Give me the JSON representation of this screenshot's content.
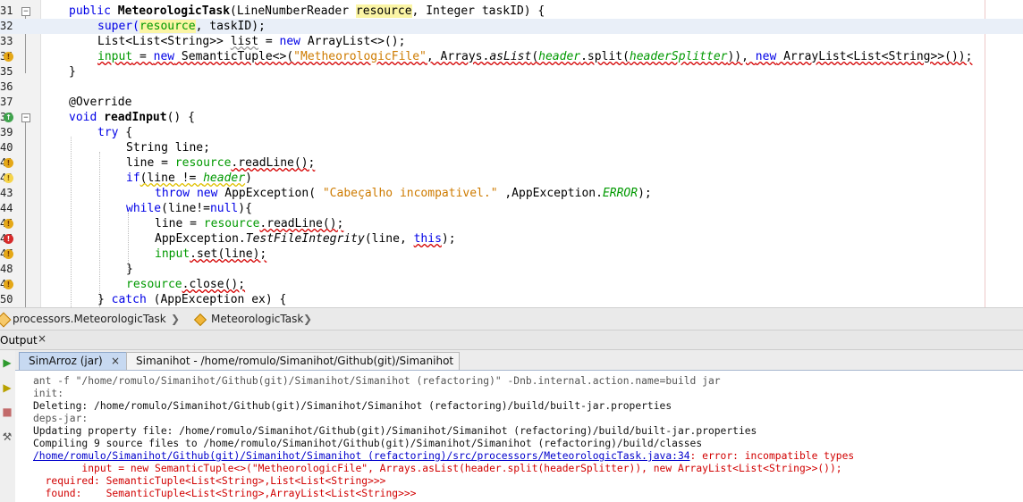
{
  "editor": {
    "lines": [
      {
        "num": "31",
        "mark": "",
        "fold": "minus"
      },
      {
        "num": "32",
        "mark": "",
        "fold": ""
      },
      {
        "num": "33",
        "mark": "",
        "fold": ""
      },
      {
        "num": "34",
        "mark": "warn",
        "fold": ""
      },
      {
        "num": "35",
        "mark": "",
        "fold": ""
      },
      {
        "num": "36",
        "mark": "",
        "fold": ""
      },
      {
        "num": "37",
        "mark": "",
        "fold": ""
      },
      {
        "num": "38",
        "mark": "impl",
        "fold": "minus"
      },
      {
        "num": "39",
        "mark": "",
        "fold": ""
      },
      {
        "num": "40",
        "mark": "",
        "fold": ""
      },
      {
        "num": "41",
        "mark": "warn",
        "fold": ""
      },
      {
        "num": "42",
        "mark": "bulb",
        "fold": ""
      },
      {
        "num": "43",
        "mark": "",
        "fold": ""
      },
      {
        "num": "44",
        "mark": "",
        "fold": ""
      },
      {
        "num": "45",
        "mark": "warn",
        "fold": ""
      },
      {
        "num": "46",
        "mark": "err",
        "fold": ""
      },
      {
        "num": "47",
        "mark": "warn",
        "fold": ""
      },
      {
        "num": "48",
        "mark": "",
        "fold": ""
      },
      {
        "num": "49",
        "mark": "warn",
        "fold": ""
      },
      {
        "num": "50",
        "mark": "",
        "fold": ""
      }
    ],
    "code": {
      "l31": {
        "a": "public ",
        "b": "MeteorologicTask",
        "c": "(LineNumberReader ",
        "d": "resource",
        ".": "",
        "e": ", Integer taskID) {"
      },
      "l32": {
        "a": "super(",
        "b": "resource",
        "c": ", taskID);"
      },
      "l33": {
        "a": "List<List<String>> ",
        "b": "list",
        "c": " = ",
        "d": "new",
        "e": " ArrayList<>();"
      },
      "l34": {
        "a": "input",
        "b": " = ",
        "c": "new",
        "d": " SemanticTuple<>(",
        "e": "\"MetheorologicFile\"",
        "f": ", Arrays.",
        "g": "asList",
        "h": "(",
        "i": "header",
        "j": ".split(",
        "k": "headerSplitter",
        "l": ")), ",
        "m": "new",
        "n": " ArrayList<List<String>>());"
      },
      "l35": {
        "a": "}"
      },
      "l37": {
        "a": "@Override"
      },
      "l38": {
        "a": "void ",
        "b": "readInput",
        "c": "() {"
      },
      "l39": {
        "a": "try",
        "b": " {"
      },
      "l40": {
        "a": "String line;"
      },
      "l41": {
        "a": "line = ",
        "b": "resource",
        "c": ".readLine();"
      },
      "l42": {
        "a": "if",
        "b": "(line != ",
        "c": "header",
        "d": ")"
      },
      "l43": {
        "a": "throw",
        "b": " ",
        "c": "new",
        "d": " AppException( ",
        "e": "\"Cabeçalho incompativel.\"",
        "f": " ,AppException.",
        "g": "ERROR",
        "h": ");"
      },
      "l44": {
        "a": "while",
        "b": "(line!=",
        "c": "null",
        "d": "){"
      },
      "l45": {
        "a": "line = ",
        "b": "resource",
        "c": ".readLine();"
      },
      "l46": {
        "a": "AppException.",
        "b": "TestFileIntegrity",
        "c": "(line, ",
        "d": "this",
        "e": ");"
      },
      "l47": {
        "a": "input",
        "b": ".set(line);"
      },
      "l48": {
        "a": "}"
      },
      "l49": {
        "a": "resource",
        "b": ".close();"
      },
      "l50": {
        "a": "} ",
        "b": "catch",
        "c": " (AppException ex) {"
      }
    }
  },
  "navbar": {
    "crumb1": "processors.MeteorologicTask",
    "crumb2": "MeteorologicTask"
  },
  "output": {
    "title": "Output",
    "tabs": [
      {
        "label": "SimArroz (jar)",
        "close": "×"
      },
      {
        "label": "Simanihot - /home/romulo/Simanihot/Github(git)/Simanihot",
        "close": "×"
      }
    ],
    "console": [
      "ant -f \"/home/romulo/Simanihot/Github(git)/Simanihot/Simanihot (refactoring)\" -Dnb.internal.action.name=build jar",
      "init:",
      "Deleting: /home/romulo/Simanihot/Github(git)/Simanihot/Simanihot (refactoring)/build/built-jar.properties",
      "deps-jar:",
      "Updating property file: /home/romulo/Simanihot/Github(git)/Simanihot/Simanihot (refactoring)/build/built-jar.properties",
      "Compiling 9 source files to /home/romulo/Simanihot/Github(git)/Simanihot/Simanihot (refactoring)/build/classes",
      "/home/romulo/Simanihot/Github(git)/Simanihot/Simanihot (refactoring)/src/processors/MeteorologicTask.java:34",
      ": error: incompatible types",
      "        input = new SemanticTuple<>(\"MetheorologicFile\", Arrays.asList(header.split(headerSplitter)), new ArrayList<List<String>>());",
      "  required: SemanticTuple<List<String>,List<List<String>>>",
      "  found:    SemanticTuple<List<String>,ArrayList<List<String>>>"
    ]
  }
}
